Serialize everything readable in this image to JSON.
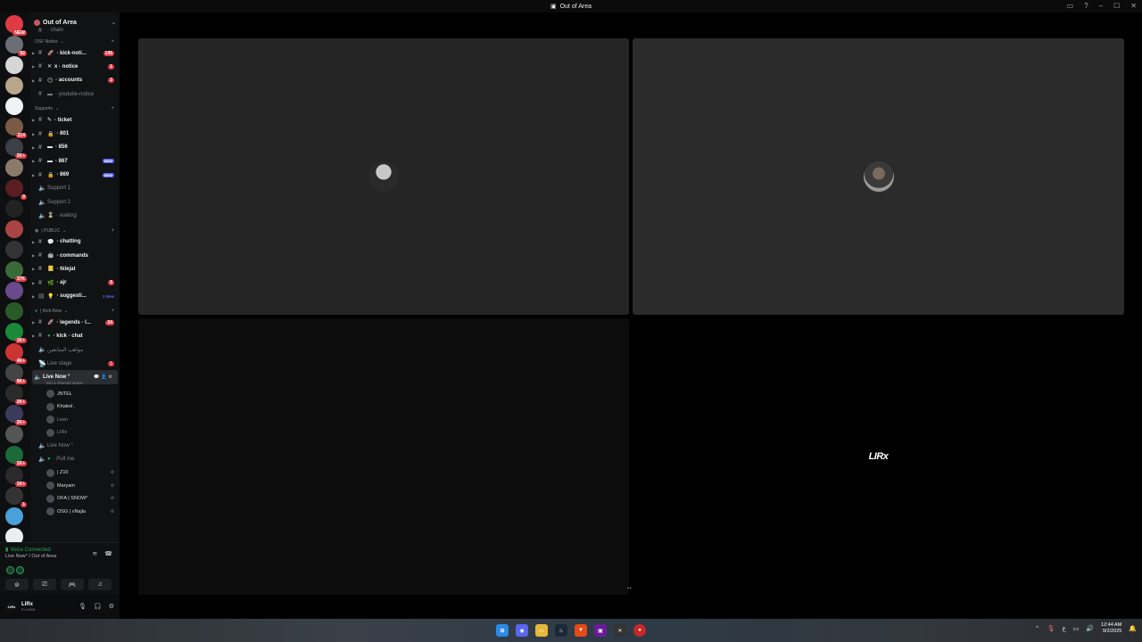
{
  "window": {
    "title": "Out of Area"
  },
  "servers": [
    {
      "badge": "NEW",
      "color": "#e03b45"
    },
    {
      "badge": "92",
      "color": "#6b6f75"
    },
    {
      "badge": "",
      "color": "#d7d7d7"
    },
    {
      "badge": "",
      "color": "#b8a58a"
    },
    {
      "badge": "",
      "color": "#f2f2f2"
    },
    {
      "badge": "214",
      "color": "#7a5a45"
    },
    {
      "badge": "2K+",
      "color": "#3a3f48"
    },
    {
      "badge": "",
      "color": "#8a7a6a"
    },
    {
      "badge": "9",
      "color": "#5a1e22"
    },
    {
      "badge": "",
      "color": "#222"
    },
    {
      "badge": "",
      "color": "#a44"
    },
    {
      "badge": "",
      "color": "#333"
    },
    {
      "badge": "37K",
      "color": "#3a6a3a"
    },
    {
      "badge": "",
      "color": "#6a4a8a"
    },
    {
      "badge": "",
      "color": "#2a5a2a"
    },
    {
      "badge": "1K+",
      "color": "#1a8a3a"
    },
    {
      "badge": "4K+",
      "color": "#c33"
    },
    {
      "badge": "9K+",
      "color": "#444"
    },
    {
      "badge": "2K+",
      "color": "#2a2a2a"
    },
    {
      "badge": "2K+",
      "color": "#3a3a5a"
    },
    {
      "badge": "",
      "color": "#555"
    },
    {
      "badge": "1K+",
      "color": "#1a6a3a"
    },
    {
      "badge": "1K+",
      "color": "#2a2a2a"
    },
    {
      "badge": "1",
      "color": "#333"
    },
    {
      "badge": "",
      "color": "#4aa0d8"
    },
    {
      "badge": "2K+",
      "color": "#eee"
    },
    {
      "badge": "",
      "color": "#7a3a3a"
    }
  ],
  "guild": {
    "name": "Out of Area"
  },
  "categories": {
    "osf": "OSF Notice",
    "supports": "Supports",
    "public": "| PUBLIC",
    "kick": "| Kick Area"
  },
  "channels": {
    "top_partial": "· chain",
    "kick_notice": "· kick-noti...",
    "kick_notice_badge": "145",
    "x_notice": "x · notice",
    "x_notice_badge": "1",
    "accounts": "· accounts",
    "accounts_badge": "2",
    "youtube": "· youtube-notice",
    "ticket": "· ticket",
    "t801": "· 801",
    "t856": "· 856",
    "t867": "· 867",
    "t867_badge": "NEW",
    "t869": "· 869",
    "t869_badge": "NEW",
    "support1": "Support 1",
    "support2": "Support 2",
    "waiting": "· waiting",
    "chatting": "· chatting",
    "commands": "· commands",
    "tklejat": "· tklejat",
    "ajr": "· ajr",
    "ajr_badge": "5",
    "suggest": "· suggesti...",
    "suggest_badge": "3 New",
    "legends": "· legends · l...",
    "legends_badge": "24",
    "kick_chat": "· kick · chat",
    "arabic": "مواهب المتابعين",
    "live_stage": "Live stage",
    "live_stage_badge": "1",
    "live_now": "Live Now °",
    "set_status": "Set a channel status",
    "live_now_2": "Live Now °",
    "pull_me": "· Pull me"
  },
  "members_live": [
    "JNTEL",
    "Khaled .",
    "Leen",
    "LIRx"
  ],
  "members_pull": [
    "| Z10",
    "Maryam",
    "OFA | SNOW°",
    "OSG | vNajla"
  ],
  "voice": {
    "status": "Voice Connected",
    "location": "Live Now° / Out of Area"
  },
  "user": {
    "name": "LIRx",
    "status": "In voice",
    "avatar_text": "LIRx"
  },
  "tiles": {
    "logo_text": "LIRx",
    "more": "..."
  },
  "clock": {
    "time": "12:44 AM",
    "date": "9/2/2025"
  },
  "tray": {
    "lang": "ع"
  }
}
